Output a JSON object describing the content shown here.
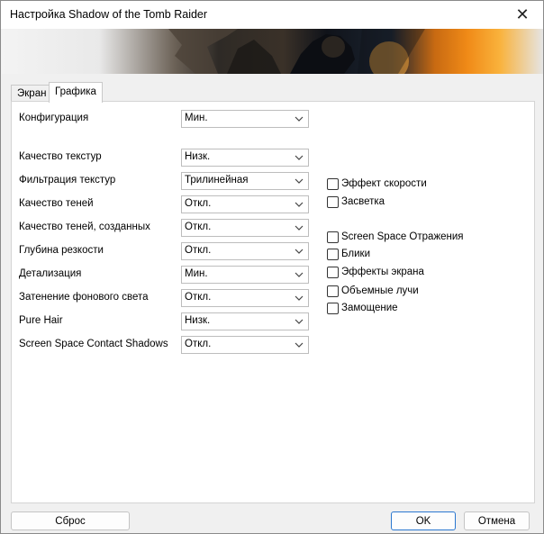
{
  "window": {
    "title": "Настройка Shadow of the Tomb Raider"
  },
  "tabs": [
    {
      "label": "Экран",
      "active": false
    },
    {
      "label": "Графика",
      "active": true
    }
  ],
  "settings": {
    "configuration": {
      "label": "Конфигурация",
      "value": "Мин."
    },
    "texture_quality": {
      "label": "Качество текстур",
      "value": "Низк."
    },
    "texture_filtering": {
      "label": "Фильтрация текстур",
      "value": "Трилинейная"
    },
    "shadow_quality": {
      "label": "Качество теней",
      "value": "Откл."
    },
    "contact_shadow_quality": {
      "label": "Качество теней, созданных",
      "value": "Откл."
    },
    "depth_of_field": {
      "label": "Глубина резкости",
      "value": "Откл."
    },
    "level_of_detail": {
      "label": "Детализация",
      "value": "Мин."
    },
    "ambient_occlusion": {
      "label": "Затенение фонового света",
      "value": "Откл."
    },
    "pure_hair": {
      "label": "Pure Hair",
      "value": "Низк."
    },
    "ss_contact_shadows": {
      "label": "Screen Space Contact Shadows",
      "value": "Откл."
    }
  },
  "checkboxes": {
    "motion_blur": {
      "label": "Эффект скорости",
      "checked": false
    },
    "bloom": {
      "label": "Засветка",
      "checked": false
    },
    "ss_reflections": {
      "label": "Screen Space Отражения",
      "checked": false
    },
    "lens_flares": {
      "label": "Блики",
      "checked": false
    },
    "screen_effects": {
      "label": "Эффекты экрана",
      "checked": false
    },
    "volumetric_lighting": {
      "label": "Объемные лучи",
      "checked": false
    },
    "tessellation": {
      "label": "Замощение",
      "checked": false
    }
  },
  "buttons": {
    "reset": "Сброс",
    "ok": "OK",
    "cancel": "Отмена"
  },
  "icons": {
    "close": "close-icon",
    "dropdown": "chevron-down-icon",
    "checkbox": "checkbox-unchecked"
  },
  "colors": {
    "accent": "#2b78d0",
    "window_bg": "#f0f0f0",
    "panel_bg": "#ffffff"
  }
}
